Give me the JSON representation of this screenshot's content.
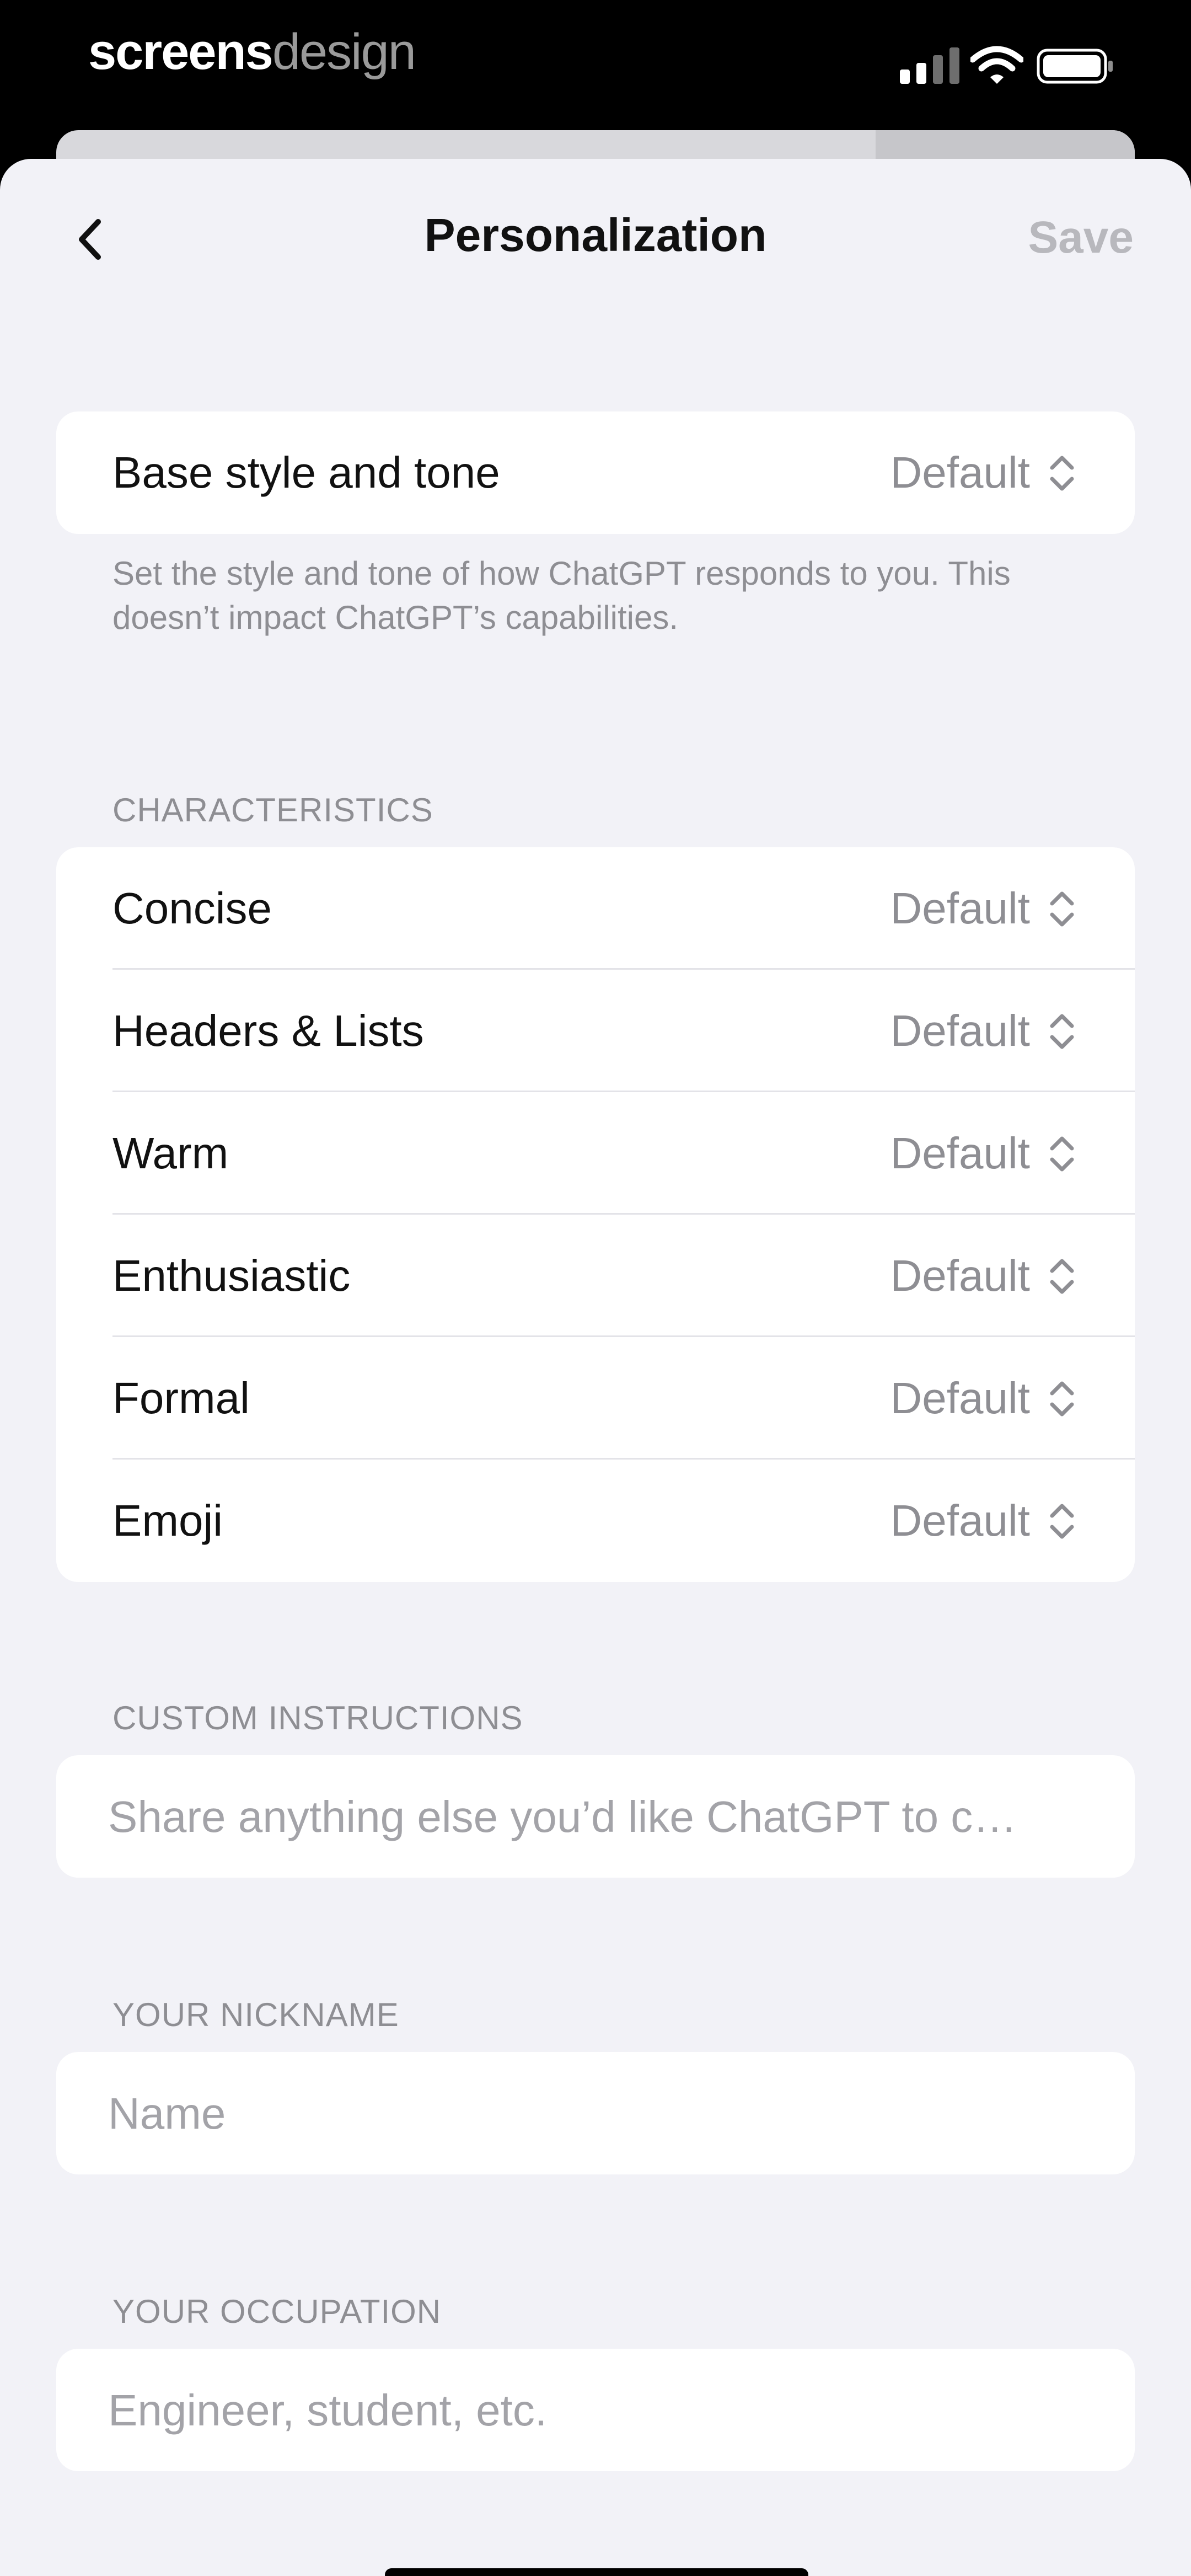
{
  "status_bar": {
    "brand_part1": "screens",
    "brand_part2": "design",
    "signal_icon": "cellular-signal-icon",
    "wifi_icon": "wifi-icon",
    "battery_icon": "battery-icon"
  },
  "nav": {
    "back_icon": "chevron-left-icon",
    "title": "Personalization",
    "save_label": "Save"
  },
  "base_style": {
    "label": "Base style and tone",
    "value": "Default",
    "helper": "Set the style and tone of how ChatGPT responds to you. This doesn’t impact ChatGPT’s capabilities."
  },
  "characteristics": {
    "header": "CHARACTERISTICS",
    "items": [
      {
        "label": "Concise",
        "value": "Default"
      },
      {
        "label": "Headers & Lists",
        "value": "Default"
      },
      {
        "label": "Warm",
        "value": "Default"
      },
      {
        "label": "Enthusiastic",
        "value": "Default"
      },
      {
        "label": "Formal",
        "value": "Default"
      },
      {
        "label": "Emoji",
        "value": "Default"
      }
    ]
  },
  "custom_instructions": {
    "header": "CUSTOM INSTRUCTIONS",
    "placeholder": "Share anything else you’d like ChatGPT to c…"
  },
  "nickname": {
    "header": "YOUR NICKNAME",
    "placeholder": "Name"
  },
  "occupation": {
    "header": "YOUR OCCUPATION",
    "placeholder": "Engineer, student, etc."
  },
  "colors": {
    "background": "#f2f2f7",
    "card": "#ffffff",
    "secondary_text": "#8e8e93",
    "save_disabled": "#b8b8bd"
  }
}
